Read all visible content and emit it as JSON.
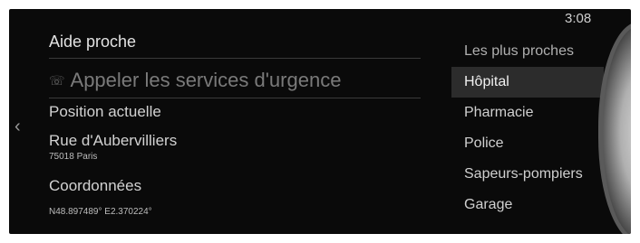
{
  "status": {
    "time": "3:08"
  },
  "panel": {
    "title": "Aide proche",
    "call_label": "Appeler les services d'urgence",
    "position_label": "Position actuelle",
    "street": "Rue d'Aubervilliers",
    "city": "75018 Paris",
    "coords_label": "Coordonnées",
    "coords_value": "N48.897489° E2.370224°"
  },
  "menu": {
    "items": [
      {
        "label": "Les plus proches"
      },
      {
        "label": "Hôpital"
      },
      {
        "label": "Pharmacie"
      },
      {
        "label": "Police"
      },
      {
        "label": "Sapeurs-pompiers"
      },
      {
        "label": "Garage"
      }
    ],
    "selected": "Hôpital"
  },
  "icons": {
    "back": "chevron-left-icon",
    "phone": "phone-icon",
    "dial": "commander-dial-icon"
  },
  "colors": {
    "background": "#0a0a0a",
    "selected_row": "#2c2c2c"
  }
}
